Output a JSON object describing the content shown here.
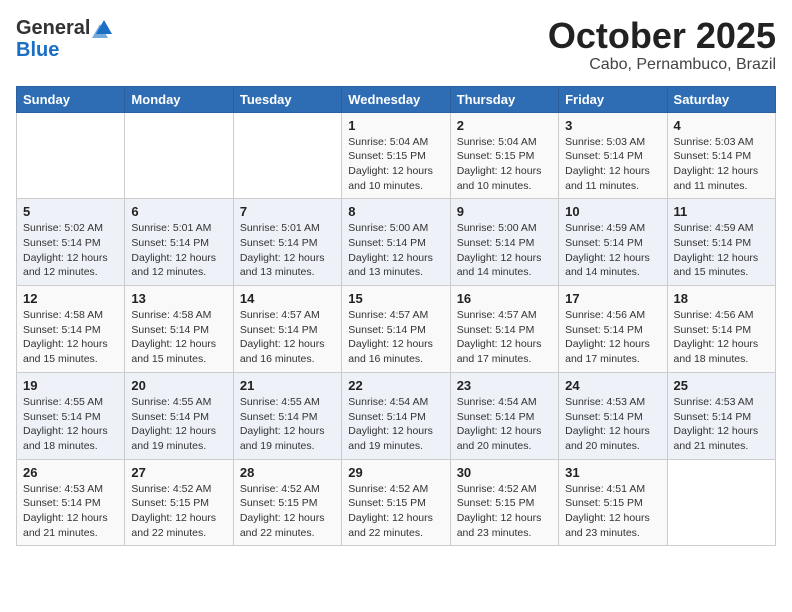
{
  "header": {
    "logo_general": "General",
    "logo_blue": "Blue",
    "month_title": "October 2025",
    "location": "Cabo, Pernambuco, Brazil"
  },
  "days_of_week": [
    "Sunday",
    "Monday",
    "Tuesday",
    "Wednesday",
    "Thursday",
    "Friday",
    "Saturday"
  ],
  "weeks": [
    [
      {
        "day": "",
        "info": ""
      },
      {
        "day": "",
        "info": ""
      },
      {
        "day": "",
        "info": ""
      },
      {
        "day": "1",
        "info": "Sunrise: 5:04 AM\nSunset: 5:15 PM\nDaylight: 12 hours\nand 10 minutes."
      },
      {
        "day": "2",
        "info": "Sunrise: 5:04 AM\nSunset: 5:15 PM\nDaylight: 12 hours\nand 10 minutes."
      },
      {
        "day": "3",
        "info": "Sunrise: 5:03 AM\nSunset: 5:14 PM\nDaylight: 12 hours\nand 11 minutes."
      },
      {
        "day": "4",
        "info": "Sunrise: 5:03 AM\nSunset: 5:14 PM\nDaylight: 12 hours\nand 11 minutes."
      }
    ],
    [
      {
        "day": "5",
        "info": "Sunrise: 5:02 AM\nSunset: 5:14 PM\nDaylight: 12 hours\nand 12 minutes."
      },
      {
        "day": "6",
        "info": "Sunrise: 5:01 AM\nSunset: 5:14 PM\nDaylight: 12 hours\nand 12 minutes."
      },
      {
        "day": "7",
        "info": "Sunrise: 5:01 AM\nSunset: 5:14 PM\nDaylight: 12 hours\nand 13 minutes."
      },
      {
        "day": "8",
        "info": "Sunrise: 5:00 AM\nSunset: 5:14 PM\nDaylight: 12 hours\nand 13 minutes."
      },
      {
        "day": "9",
        "info": "Sunrise: 5:00 AM\nSunset: 5:14 PM\nDaylight: 12 hours\nand 14 minutes."
      },
      {
        "day": "10",
        "info": "Sunrise: 4:59 AM\nSunset: 5:14 PM\nDaylight: 12 hours\nand 14 minutes."
      },
      {
        "day": "11",
        "info": "Sunrise: 4:59 AM\nSunset: 5:14 PM\nDaylight: 12 hours\nand 15 minutes."
      }
    ],
    [
      {
        "day": "12",
        "info": "Sunrise: 4:58 AM\nSunset: 5:14 PM\nDaylight: 12 hours\nand 15 minutes."
      },
      {
        "day": "13",
        "info": "Sunrise: 4:58 AM\nSunset: 5:14 PM\nDaylight: 12 hours\nand 15 minutes."
      },
      {
        "day": "14",
        "info": "Sunrise: 4:57 AM\nSunset: 5:14 PM\nDaylight: 12 hours\nand 16 minutes."
      },
      {
        "day": "15",
        "info": "Sunrise: 4:57 AM\nSunset: 5:14 PM\nDaylight: 12 hours\nand 16 minutes."
      },
      {
        "day": "16",
        "info": "Sunrise: 4:57 AM\nSunset: 5:14 PM\nDaylight: 12 hours\nand 17 minutes."
      },
      {
        "day": "17",
        "info": "Sunrise: 4:56 AM\nSunset: 5:14 PM\nDaylight: 12 hours\nand 17 minutes."
      },
      {
        "day": "18",
        "info": "Sunrise: 4:56 AM\nSunset: 5:14 PM\nDaylight: 12 hours\nand 18 minutes."
      }
    ],
    [
      {
        "day": "19",
        "info": "Sunrise: 4:55 AM\nSunset: 5:14 PM\nDaylight: 12 hours\nand 18 minutes."
      },
      {
        "day": "20",
        "info": "Sunrise: 4:55 AM\nSunset: 5:14 PM\nDaylight: 12 hours\nand 19 minutes."
      },
      {
        "day": "21",
        "info": "Sunrise: 4:55 AM\nSunset: 5:14 PM\nDaylight: 12 hours\nand 19 minutes."
      },
      {
        "day": "22",
        "info": "Sunrise: 4:54 AM\nSunset: 5:14 PM\nDaylight: 12 hours\nand 19 minutes."
      },
      {
        "day": "23",
        "info": "Sunrise: 4:54 AM\nSunset: 5:14 PM\nDaylight: 12 hours\nand 20 minutes."
      },
      {
        "day": "24",
        "info": "Sunrise: 4:53 AM\nSunset: 5:14 PM\nDaylight: 12 hours\nand 20 minutes."
      },
      {
        "day": "25",
        "info": "Sunrise: 4:53 AM\nSunset: 5:14 PM\nDaylight: 12 hours\nand 21 minutes."
      }
    ],
    [
      {
        "day": "26",
        "info": "Sunrise: 4:53 AM\nSunset: 5:14 PM\nDaylight: 12 hours\nand 21 minutes."
      },
      {
        "day": "27",
        "info": "Sunrise: 4:52 AM\nSunset: 5:15 PM\nDaylight: 12 hours\nand 22 minutes."
      },
      {
        "day": "28",
        "info": "Sunrise: 4:52 AM\nSunset: 5:15 PM\nDaylight: 12 hours\nand 22 minutes."
      },
      {
        "day": "29",
        "info": "Sunrise: 4:52 AM\nSunset: 5:15 PM\nDaylight: 12 hours\nand 22 minutes."
      },
      {
        "day": "30",
        "info": "Sunrise: 4:52 AM\nSunset: 5:15 PM\nDaylight: 12 hours\nand 23 minutes."
      },
      {
        "day": "31",
        "info": "Sunrise: 4:51 AM\nSunset: 5:15 PM\nDaylight: 12 hours\nand 23 minutes."
      },
      {
        "day": "",
        "info": ""
      }
    ]
  ]
}
